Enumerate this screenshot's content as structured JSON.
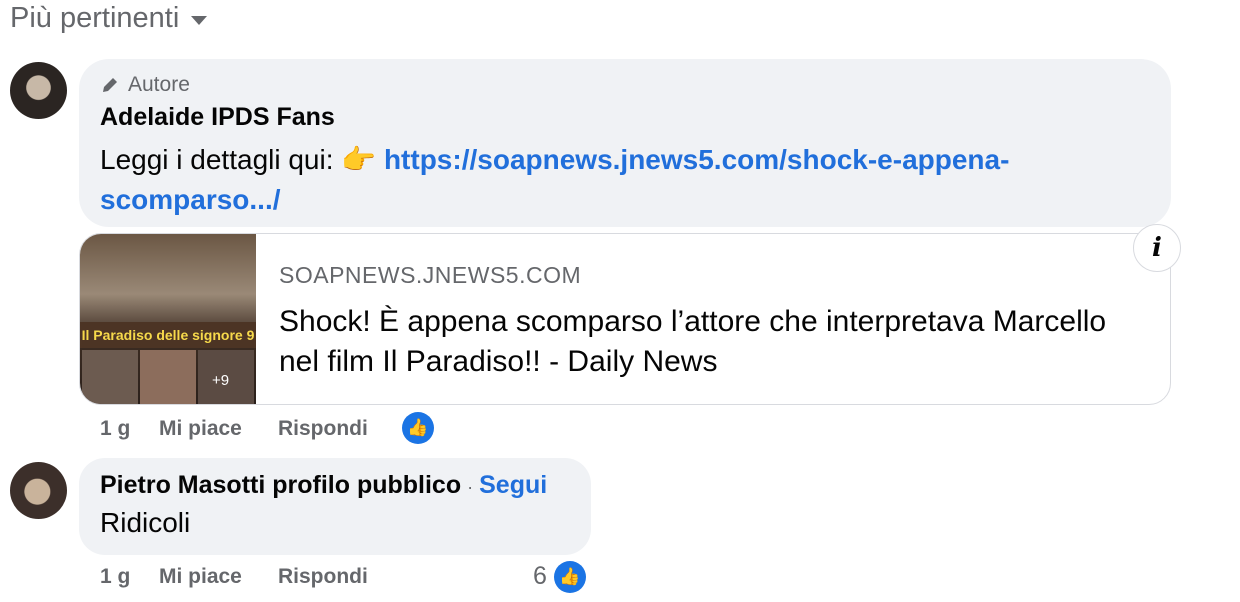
{
  "sort": {
    "label": "Più pertinenti"
  },
  "comment1": {
    "badge": "Autore",
    "author": "Adelaide IPDS Fans",
    "text_prefix": "Leggi i dettagli qui:",
    "emoji": "👉",
    "link": "https://soapnews.jnews5.com/shock-e-appena-scomparso.../",
    "preview": {
      "domain": "SOAPNEWS.JNEWS5.COM",
      "title": "Shock! È appena scomparso l’attore che interpretava Marcello nel film Il Paradiso!! - Daily News",
      "thumb_caption": "Il Paradiso delle signore 9",
      "thumb_more": "+9",
      "info_icon": "i"
    },
    "time": "1 g",
    "like": "Mi piace",
    "reply": "Rispondi",
    "like_icon": "👍"
  },
  "comment2": {
    "author": "Pietro Masotti profilo pubblico",
    "separator": "·",
    "follow": "Segui",
    "text": "Ridicoli",
    "time": "1 g",
    "like": "Mi piace",
    "reply": "Rispondi",
    "reaction_count": "6",
    "like_icon": "👍"
  },
  "colors": {
    "link": "#216fdb",
    "like_badge": "#1b74e4",
    "bubble": "#f0f2f5",
    "muted": "#65676b"
  }
}
